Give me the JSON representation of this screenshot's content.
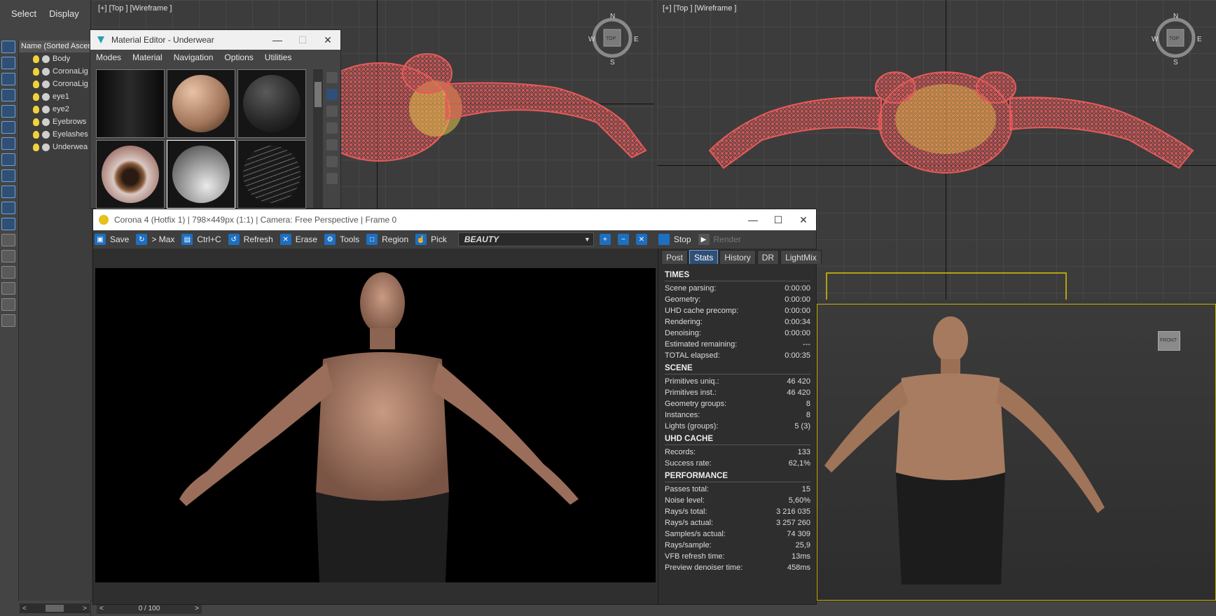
{
  "explorer": {
    "menu": [
      "Select",
      "Display"
    ],
    "header": "Name (Sorted Ascen",
    "items": [
      {
        "label": "Body",
        "kind": "object"
      },
      {
        "label": "CoronaLig",
        "kind": "light"
      },
      {
        "label": "CoronaLig",
        "kind": "light"
      },
      {
        "label": "eye1",
        "kind": "object"
      },
      {
        "label": "eye2",
        "kind": "object"
      },
      {
        "label": "Eyebrows",
        "kind": "object"
      },
      {
        "label": "Eyelashes",
        "kind": "object"
      },
      {
        "label": "Underwea",
        "kind": "object"
      }
    ]
  },
  "viewports": {
    "top_left": {
      "label": "[+] [Top ] [Wireframe ]"
    },
    "top_right": {
      "label": "[+] [Top ] [Wireframe ]"
    },
    "compass": {
      "n": "N",
      "s": "S",
      "e": "E",
      "w": "W",
      "center": "TOP"
    },
    "perspective": {
      "cube_label": "FRONT"
    }
  },
  "material_editor": {
    "title": "Material Editor - Underwear",
    "menu": [
      "Modes",
      "Material",
      "Navigation",
      "Options",
      "Utilities"
    ],
    "slots": [
      "dark-room",
      "skin-sphere",
      "black-sphere",
      "eye-sphere",
      "glass-sphere",
      "wire-sphere"
    ],
    "side_tools": [
      "sphere-icon",
      "cylinder-icon",
      "checker-icon",
      "box-icon",
      "color-icon",
      "paint-icon",
      "assign-icon",
      "pick-icon"
    ]
  },
  "vfb": {
    "title": "Corona 4 (Hotfix 1) | 798×449px (1:1) | Camera: Free Perspective | Frame 0",
    "toolbar": {
      "save": "Save",
      "max": "> Max",
      "copy": "Ctrl+C",
      "refresh": "Refresh",
      "erase": "Erase",
      "tools": "Tools",
      "region": "Region",
      "pick": "Pick",
      "channel": "BEAUTY",
      "stop": "Stop",
      "render": "Render"
    },
    "tabs": [
      "Post",
      "Stats",
      "History",
      "DR",
      "LightMix"
    ],
    "active_tab": "Stats",
    "stats": {
      "times": {
        "title": "TIMES",
        "rows": [
          {
            "k": "Scene parsing:",
            "v": "0:00:00"
          },
          {
            "k": "Geometry:",
            "v": "0:00:00"
          },
          {
            "k": "UHD cache precomp:",
            "v": "0:00:00"
          },
          {
            "k": "Rendering:",
            "v": "0:00:34"
          },
          {
            "k": "Denoising:",
            "v": "0:00:00"
          },
          {
            "k": "Estimated remaining:",
            "v": "---"
          },
          {
            "k": "TOTAL elapsed:",
            "v": "0:00:35"
          }
        ]
      },
      "scene": {
        "title": "SCENE",
        "rows": [
          {
            "k": "Primitives uniq.:",
            "v": "46 420"
          },
          {
            "k": "Primitives inst.:",
            "v": "46 420"
          },
          {
            "k": "Geometry groups:",
            "v": "8"
          },
          {
            "k": "Instances:",
            "v": "8"
          },
          {
            "k": "Lights (groups):",
            "v": "5 (3)"
          }
        ]
      },
      "uhd": {
        "title": "UHD CACHE",
        "rows": [
          {
            "k": "Records:",
            "v": "133"
          },
          {
            "k": "Success rate:",
            "v": "62,1%"
          }
        ]
      },
      "performance": {
        "title": "PERFORMANCE",
        "rows": [
          {
            "k": "Passes total:",
            "v": "15"
          },
          {
            "k": "Noise level:",
            "v": "5,60%"
          },
          {
            "k": "Rays/s total:",
            "v": "3 216 035"
          },
          {
            "k": "Rays/s actual:",
            "v": "3 257 260"
          },
          {
            "k": "Samples/s actual:",
            "v": "74 309"
          },
          {
            "k": "Rays/sample:",
            "v": "25,9"
          },
          {
            "k": "VFB refresh time:",
            "v": "13ms"
          },
          {
            "k": "Preview denoiser time:",
            "v": "458ms"
          }
        ]
      }
    }
  },
  "timeline": {
    "frame": "0 / 100"
  },
  "colors": {
    "accent": "#1e6fc0",
    "wire": "#e65a5a",
    "wire_yellow": "#e3c24a",
    "selection": "#c8b400"
  }
}
